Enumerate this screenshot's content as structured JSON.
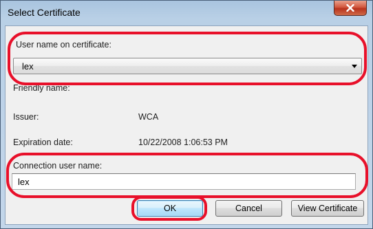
{
  "dialog": {
    "title": "Select Certificate"
  },
  "fields": {
    "user_name_label": "User name on certificate:",
    "user_name_value": "lex",
    "friendly_name_label": "Friendly name:",
    "issuer_label": "Issuer:",
    "issuer_value": "WCA",
    "expiration_label": "Expiration date:",
    "expiration_value": "10/22/2008 1:06:53 PM",
    "connection_user_label": "Connection user name:",
    "connection_user_value": "lex"
  },
  "buttons": {
    "ok": "OK",
    "cancel": "Cancel",
    "view_certificate": "View Certificate"
  },
  "colors": {
    "highlight": "#e8102a",
    "close_button": "#c4412b"
  },
  "icons": {
    "close": "close-icon",
    "dropdown": "chevron-down-icon"
  }
}
